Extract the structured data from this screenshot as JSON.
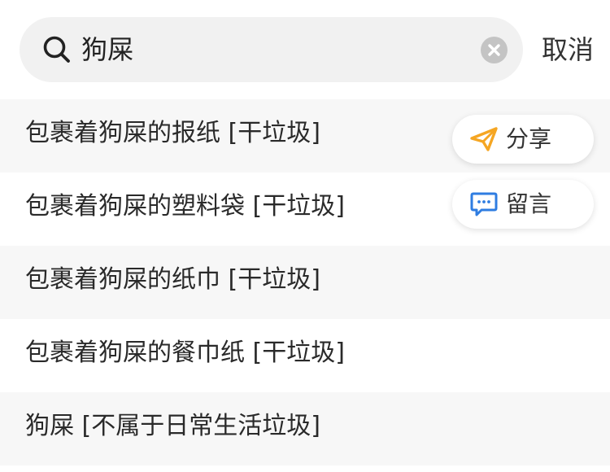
{
  "search": {
    "query": "狗屎",
    "cancel_label": "取消"
  },
  "results": [
    "包裹着狗屎的报纸 [干垃圾]",
    "包裹着狗屎的塑料袋 [干垃圾]",
    "包裹着狗屎的纸巾 [干垃圾]",
    "包裹着狗屎的餐巾纸 [干垃圾]",
    "狗屎 [不属于日常生活垃圾]"
  ],
  "actions": {
    "share_label": "分享",
    "comment_label": "留言"
  },
  "icons": {
    "search": "search-icon",
    "clear": "clear-icon",
    "share": "paper-plane-icon",
    "comment": "chat-bubble-icon"
  },
  "colors": {
    "share_icon": "#f5a623",
    "comment_icon": "#2f7de1",
    "row_alt_bg": "#f7f7f7"
  }
}
